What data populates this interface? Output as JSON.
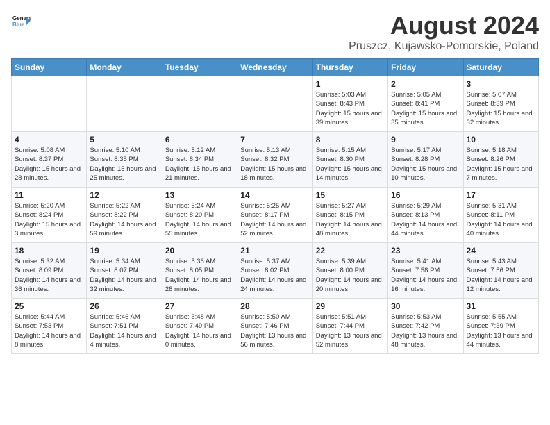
{
  "header": {
    "logo_line1": "General",
    "logo_line2": "Blue",
    "month_title": "August 2024",
    "subtitle": "Pruszcz, Kujawsko-Pomorskie, Poland"
  },
  "days_of_week": [
    "Sunday",
    "Monday",
    "Tuesday",
    "Wednesday",
    "Thursday",
    "Friday",
    "Saturday"
  ],
  "weeks": [
    [
      {
        "day": "",
        "detail": ""
      },
      {
        "day": "",
        "detail": ""
      },
      {
        "day": "",
        "detail": ""
      },
      {
        "day": "",
        "detail": ""
      },
      {
        "day": "1",
        "detail": "Sunrise: 5:03 AM\nSunset: 8:43 PM\nDaylight: 15 hours\nand 39 minutes."
      },
      {
        "day": "2",
        "detail": "Sunrise: 5:05 AM\nSunset: 8:41 PM\nDaylight: 15 hours\nand 35 minutes."
      },
      {
        "day": "3",
        "detail": "Sunrise: 5:07 AM\nSunset: 8:39 PM\nDaylight: 15 hours\nand 32 minutes."
      }
    ],
    [
      {
        "day": "4",
        "detail": "Sunrise: 5:08 AM\nSunset: 8:37 PM\nDaylight: 15 hours\nand 28 minutes."
      },
      {
        "day": "5",
        "detail": "Sunrise: 5:10 AM\nSunset: 8:35 PM\nDaylight: 15 hours\nand 25 minutes."
      },
      {
        "day": "6",
        "detail": "Sunrise: 5:12 AM\nSunset: 8:34 PM\nDaylight: 15 hours\nand 21 minutes."
      },
      {
        "day": "7",
        "detail": "Sunrise: 5:13 AM\nSunset: 8:32 PM\nDaylight: 15 hours\nand 18 minutes."
      },
      {
        "day": "8",
        "detail": "Sunrise: 5:15 AM\nSunset: 8:30 PM\nDaylight: 15 hours\nand 14 minutes."
      },
      {
        "day": "9",
        "detail": "Sunrise: 5:17 AM\nSunset: 8:28 PM\nDaylight: 15 hours\nand 10 minutes."
      },
      {
        "day": "10",
        "detail": "Sunrise: 5:18 AM\nSunset: 8:26 PM\nDaylight: 15 hours\nand 7 minutes."
      }
    ],
    [
      {
        "day": "11",
        "detail": "Sunrise: 5:20 AM\nSunset: 8:24 PM\nDaylight: 15 hours\nand 3 minutes."
      },
      {
        "day": "12",
        "detail": "Sunrise: 5:22 AM\nSunset: 8:22 PM\nDaylight: 14 hours\nand 59 minutes."
      },
      {
        "day": "13",
        "detail": "Sunrise: 5:24 AM\nSunset: 8:20 PM\nDaylight: 14 hours\nand 55 minutes."
      },
      {
        "day": "14",
        "detail": "Sunrise: 5:25 AM\nSunset: 8:17 PM\nDaylight: 14 hours\nand 52 minutes."
      },
      {
        "day": "15",
        "detail": "Sunrise: 5:27 AM\nSunset: 8:15 PM\nDaylight: 14 hours\nand 48 minutes."
      },
      {
        "day": "16",
        "detail": "Sunrise: 5:29 AM\nSunset: 8:13 PM\nDaylight: 14 hours\nand 44 minutes."
      },
      {
        "day": "17",
        "detail": "Sunrise: 5:31 AM\nSunset: 8:11 PM\nDaylight: 14 hours\nand 40 minutes."
      }
    ],
    [
      {
        "day": "18",
        "detail": "Sunrise: 5:32 AM\nSunset: 8:09 PM\nDaylight: 14 hours\nand 36 minutes."
      },
      {
        "day": "19",
        "detail": "Sunrise: 5:34 AM\nSunset: 8:07 PM\nDaylight: 14 hours\nand 32 minutes."
      },
      {
        "day": "20",
        "detail": "Sunrise: 5:36 AM\nSunset: 8:05 PM\nDaylight: 14 hours\nand 28 minutes."
      },
      {
        "day": "21",
        "detail": "Sunrise: 5:37 AM\nSunset: 8:02 PM\nDaylight: 14 hours\nand 24 minutes."
      },
      {
        "day": "22",
        "detail": "Sunrise: 5:39 AM\nSunset: 8:00 PM\nDaylight: 14 hours\nand 20 minutes."
      },
      {
        "day": "23",
        "detail": "Sunrise: 5:41 AM\nSunset: 7:58 PM\nDaylight: 14 hours\nand 16 minutes."
      },
      {
        "day": "24",
        "detail": "Sunrise: 5:43 AM\nSunset: 7:56 PM\nDaylight: 14 hours\nand 12 minutes."
      }
    ],
    [
      {
        "day": "25",
        "detail": "Sunrise: 5:44 AM\nSunset: 7:53 PM\nDaylight: 14 hours\nand 8 minutes."
      },
      {
        "day": "26",
        "detail": "Sunrise: 5:46 AM\nSunset: 7:51 PM\nDaylight: 14 hours\nand 4 minutes."
      },
      {
        "day": "27",
        "detail": "Sunrise: 5:48 AM\nSunset: 7:49 PM\nDaylight: 14 hours\nand 0 minutes."
      },
      {
        "day": "28",
        "detail": "Sunrise: 5:50 AM\nSunset: 7:46 PM\nDaylight: 13 hours\nand 56 minutes."
      },
      {
        "day": "29",
        "detail": "Sunrise: 5:51 AM\nSunset: 7:44 PM\nDaylight: 13 hours\nand 52 minutes."
      },
      {
        "day": "30",
        "detail": "Sunrise: 5:53 AM\nSunset: 7:42 PM\nDaylight: 13 hours\nand 48 minutes."
      },
      {
        "day": "31",
        "detail": "Sunrise: 5:55 AM\nSunset: 7:39 PM\nDaylight: 13 hours\nand 44 minutes."
      }
    ]
  ]
}
